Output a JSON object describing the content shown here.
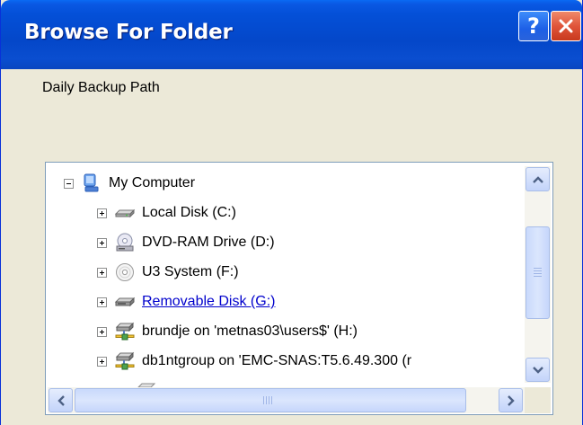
{
  "window": {
    "title": "Browse For Folder",
    "prompt": "Daily Backup Path"
  },
  "title_buttons": {
    "help": "?",
    "close": "×"
  },
  "tree": {
    "root": {
      "label": "My Computer",
      "icon": "my-computer-icon",
      "expanded": true
    },
    "items": [
      {
        "label": "Local Disk (C:)",
        "icon": "hard-disk-icon"
      },
      {
        "label": "DVD-RAM Drive (D:)",
        "icon": "dvd-drive-icon"
      },
      {
        "label": "U3 System (F:)",
        "icon": "cd-drive-icon"
      },
      {
        "label": "Removable Disk (G:)",
        "icon": "removable-disk-icon",
        "highlighted": true
      },
      {
        "label": "brundje on 'metnas03\\users$' (H:)",
        "icon": "network-drive-icon"
      },
      {
        "label": "db1ntgroup on 'EMC-SNAS:T5.6.49.300 (r",
        "icon": "network-drive-icon"
      }
    ]
  },
  "colors": {
    "titlebar": "#0450d8",
    "window_bg": "#ece9d8",
    "link": "#0000cc",
    "close_button": "#e0553a"
  }
}
